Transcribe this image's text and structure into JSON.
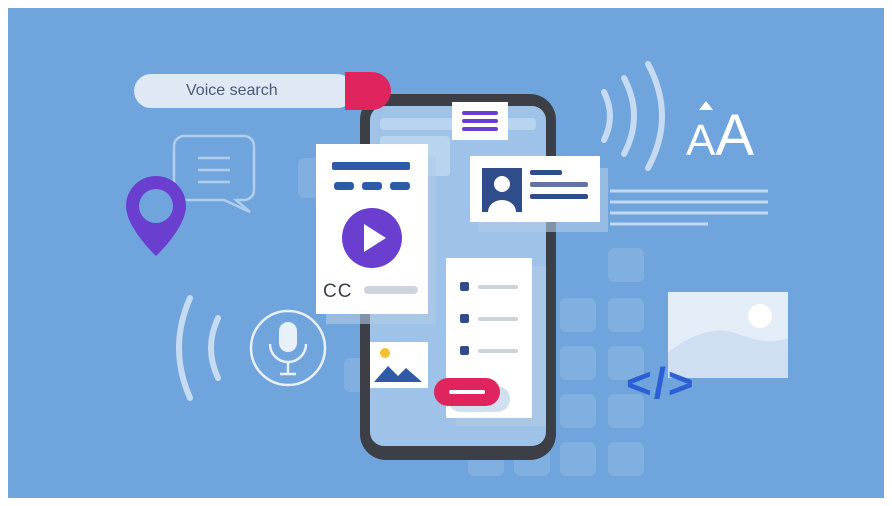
{
  "search": {
    "label": "Voice search",
    "icon": "magnifier-icon"
  },
  "card": {
    "caption_label": "CC",
    "play_icon": "play-icon"
  },
  "typography": {
    "label": "AA",
    "small": "A",
    "large": "A"
  },
  "code": {
    "label": "</>"
  },
  "colors": {
    "background": "#6fa5dc",
    "accent_red": "#e0245e",
    "accent_purple": "#6a3fd0",
    "code_blue": "#2c5fd6",
    "phone_frame": "#3c3f46"
  }
}
